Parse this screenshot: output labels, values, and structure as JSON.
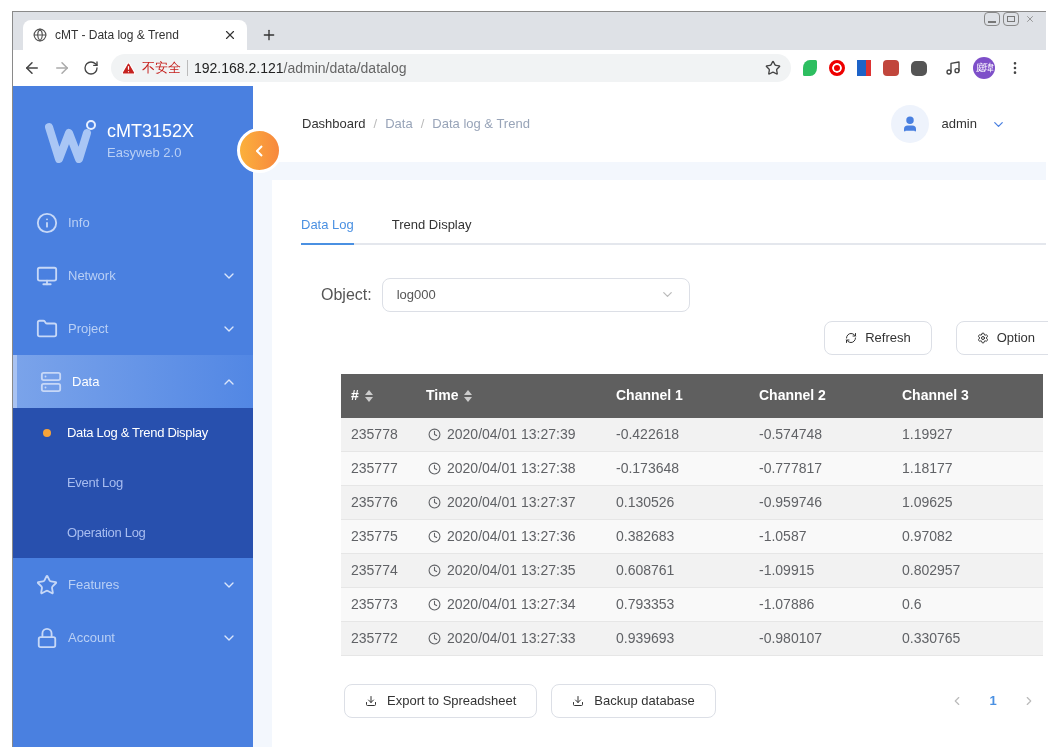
{
  "browser": {
    "tab_title": "cMT - Data log & Trend",
    "security_label": "不安全",
    "url_host": "192.168.2.121",
    "url_path": "/admin/data/datalog",
    "profile_initials": "庭瑋"
  },
  "sidebar": {
    "brand": "cMT3152X",
    "subtitle": "Easyweb 2.0",
    "items": [
      {
        "kind": "info",
        "label": "Info",
        "selected": false
      },
      {
        "kind": "network",
        "label": "Network",
        "expanded": false,
        "selected": false
      },
      {
        "kind": "project",
        "label": "Project",
        "expanded": false,
        "selected": false
      },
      {
        "kind": "data",
        "label": "Data",
        "expanded": true,
        "selected": true,
        "children": [
          {
            "label": "Data Log & Trend Display",
            "selected": true
          },
          {
            "label": "Event Log",
            "selected": false
          },
          {
            "label": "Operation Log",
            "selected": false
          }
        ]
      },
      {
        "kind": "features",
        "label": "Features",
        "expanded": false,
        "selected": false
      },
      {
        "kind": "account",
        "label": "Account",
        "expanded": false,
        "selected": false
      }
    ]
  },
  "breadcrumb": [
    "Dashboard",
    "Data",
    "Data log & Trend"
  ],
  "breadcrumb_separator": "/",
  "user": {
    "name": "admin"
  },
  "tabs": [
    {
      "label": "Data Log",
      "selected": true
    },
    {
      "label": "Trend Display",
      "selected": false
    }
  ],
  "object": {
    "label": "Object:",
    "value": "log000"
  },
  "actions": [
    "Refresh",
    "Option"
  ],
  "table": {
    "columns": [
      {
        "label": "#",
        "sortable": true
      },
      {
        "label": "Time",
        "sortable": true
      },
      {
        "label": "Channel 1",
        "sortable": false
      },
      {
        "label": "Channel 2",
        "sortable": false
      },
      {
        "label": "Channel 3",
        "sortable": false
      }
    ],
    "rows": [
      [
        "235778",
        "2020/04/01 13:27:39",
        "-0.422618",
        "-0.574748",
        "1.19927"
      ],
      [
        "235777",
        "2020/04/01 13:27:38",
        "-0.173648",
        "-0.777817",
        "1.18177"
      ],
      [
        "235776",
        "2020/04/01 13:27:37",
        "0.130526",
        "-0.959746",
        "1.09625"
      ],
      [
        "235775",
        "2020/04/01 13:27:36",
        "0.382683",
        "-1.0587",
        "0.97082"
      ],
      [
        "235774",
        "2020/04/01 13:27:35",
        "0.608761",
        "-1.09915",
        "0.802957"
      ],
      [
        "235773",
        "2020/04/01 13:27:34",
        "0.793353",
        "-1.07886",
        "0.6"
      ],
      [
        "235772",
        "2020/04/01 13:27:33",
        "0.939693",
        "-0.980107",
        "0.330765"
      ]
    ]
  },
  "footer_buttons": [
    "Export to Spreadsheet",
    "Backup database"
  ],
  "pagination": {
    "pages": [
      {
        "label": "1",
        "selected": true
      }
    ]
  }
}
